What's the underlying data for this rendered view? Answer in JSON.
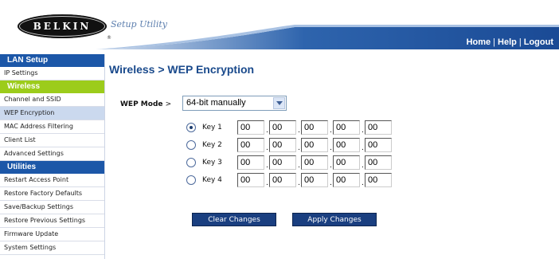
{
  "brand": {
    "logo_text": "BELKIN",
    "logo_mark": "®",
    "tagline": "Setup Utility"
  },
  "toplinks": {
    "home": "Home",
    "help": "Help",
    "logout": "Logout",
    "separator": "|"
  },
  "sidebar": {
    "sections": [
      {
        "heading": "LAN Setup",
        "items": [
          "IP Settings"
        ]
      },
      {
        "heading": "Wireless",
        "items": [
          "Channel and SSID",
          "WEP Encryption",
          "MAC Address Filtering",
          "Client List",
          "Advanced Settings"
        ]
      },
      {
        "heading": "Utilities",
        "items": [
          "Restart Access Point",
          "Restore Factory Defaults",
          "Save/Backup Settings",
          "Restore Previous Settings",
          "Firmware Update",
          "System Settings"
        ]
      }
    ],
    "active_item": "WEP Encryption"
  },
  "main": {
    "title": "Wireless > WEP Encryption",
    "wep_mode_label": "WEP Mode",
    "wep_mode_sep": ">",
    "wep_mode_value": "64-bit manually",
    "keys": [
      {
        "label": "Key 1",
        "selected": true,
        "values": [
          "00",
          "00",
          "00",
          "00",
          "00"
        ]
      },
      {
        "label": "Key 2",
        "selected": false,
        "values": [
          "00",
          "00",
          "00",
          "00",
          "00"
        ]
      },
      {
        "label": "Key 3",
        "selected": false,
        "values": [
          "00",
          "00",
          "00",
          "00",
          "00"
        ]
      },
      {
        "label": "Key 4",
        "selected": false,
        "values": [
          "00",
          "00",
          "00",
          "00",
          "00"
        ]
      }
    ],
    "clear_button": "Clear Changes",
    "apply_button": "Apply Changes"
  },
  "colors": {
    "sidebar_heading": "#1c57a8",
    "sidebar_heading_wireless": "#9ccc1b",
    "active_item": "#cbd9ee",
    "button": "#1a3f80",
    "title": "#1a4a8c"
  },
  "icons": {
    "dropdown": "chevron-down-icon",
    "radio": "radio-button-icon"
  }
}
